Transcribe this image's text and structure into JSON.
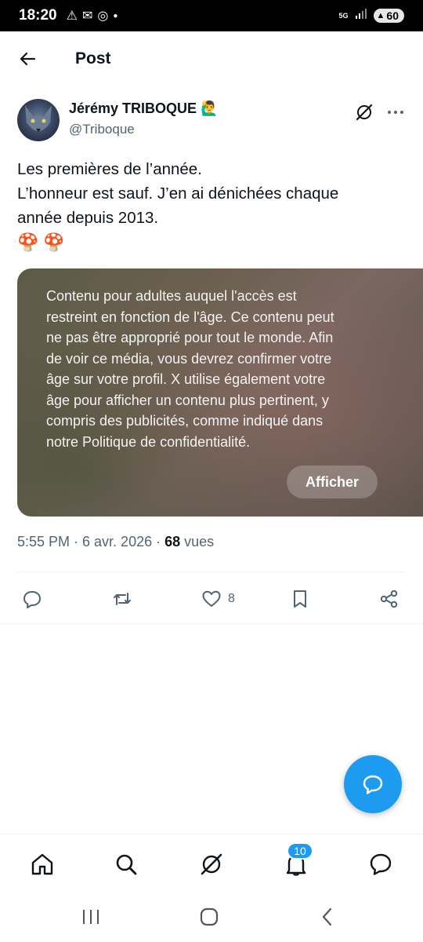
{
  "status_bar": {
    "time": "18:20",
    "network": "5G",
    "battery": "60"
  },
  "header": {
    "title": "Post"
  },
  "author": {
    "name": "Jérémy TRIBOQUE",
    "badge_emoji": "🙋‍♂️",
    "handle": "@Triboque"
  },
  "post": {
    "lines": [
      "Les premières de l’année.",
      "L’honneur est sauf. J’en ai dénichées chaque",
      "année depuis 2013."
    ],
    "emojis": [
      "🍄",
      "🍄"
    ]
  },
  "media": {
    "warning_lines": [
      "Contenu pour adultes auquel l'accès est",
      "restreint en fonction de l'âge. Ce contenu peut",
      "ne pas être approprié pour tout le monde. Afin",
      "de voir ce média, vous devrez confirmer votre",
      "âge sur votre profil. X utilise également votre",
      "âge pour afficher un contenu plus pertinent, y",
      "compris des publicités, comme indiqué dans",
      "notre Politique de confidentialité."
    ],
    "show_label": "Afficher"
  },
  "meta": {
    "time_date": "5:55 PM · 6 avr. 2026 · ",
    "views_count": "68",
    "views_label": " vues"
  },
  "actions": {
    "likes_count": "8"
  },
  "nav": {
    "notifications_badge": "10"
  },
  "icons": {
    "back": "arrow-left-icon",
    "grok": "grok-icon",
    "more": "more-icon",
    "reply": "reply-icon",
    "repost": "repost-icon",
    "like": "heart-icon",
    "bookmark": "bookmark-icon",
    "share": "share-icon",
    "fab": "chat-bubble-icon",
    "home": "home-icon",
    "search": "search-icon",
    "notifications": "bell-icon",
    "messages": "message-icon"
  },
  "colors": {
    "accent": "#1d9bf0",
    "text_secondary": "#536471"
  }
}
